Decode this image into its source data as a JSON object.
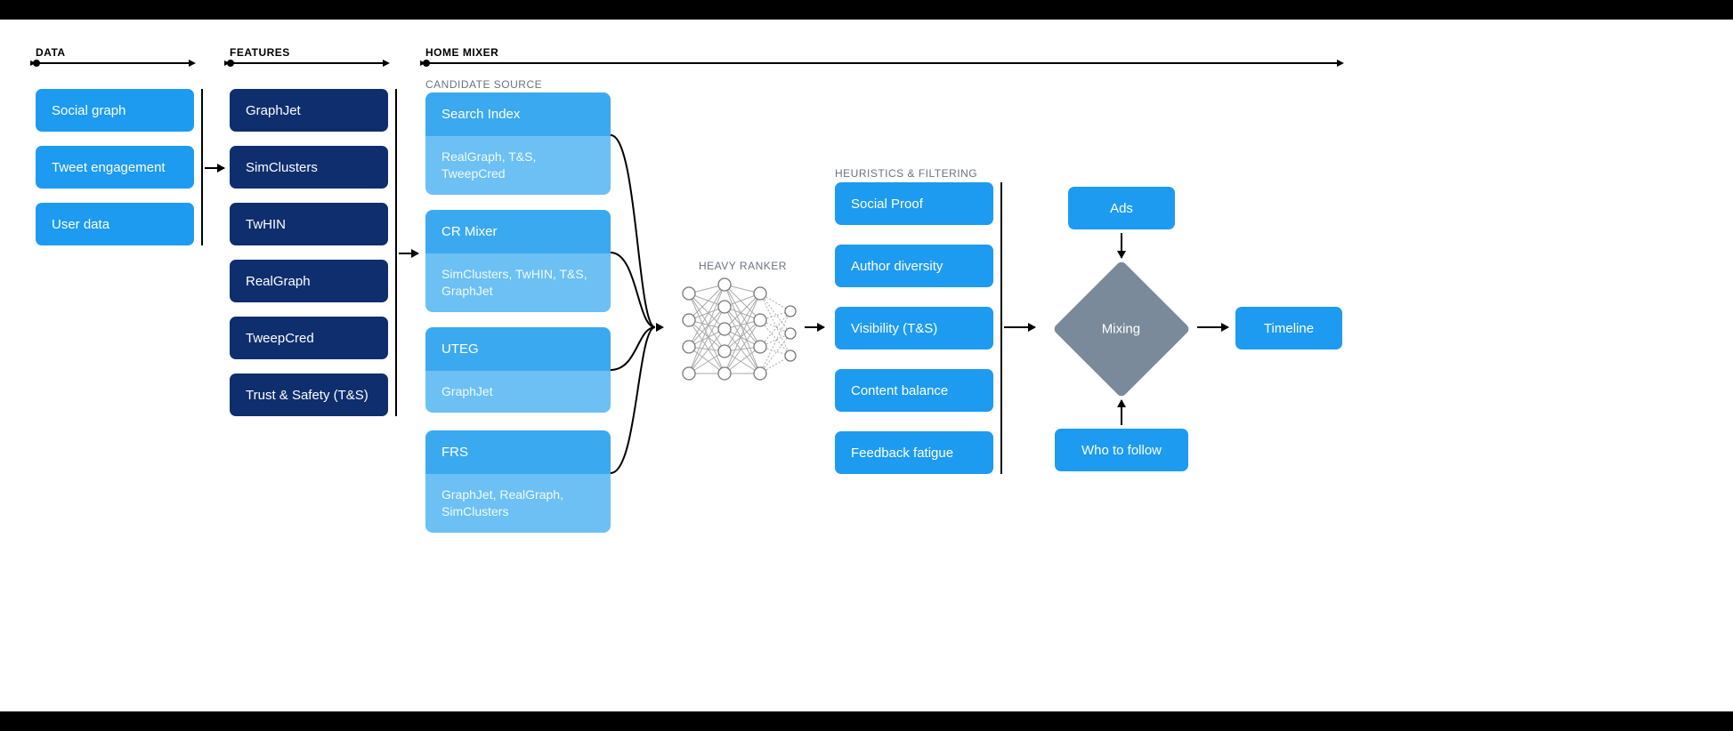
{
  "sections": {
    "data": "DATA",
    "features": "FEATURES",
    "home_mixer": "HOME MIXER"
  },
  "subsections": {
    "candidate_source": "CANDIDATE SOURCE",
    "heavy_ranker": "HEAVY RANKER",
    "heuristics": "HEURISTICS & FILTERING"
  },
  "data_col": [
    "Social graph",
    "Tweet engagement",
    "User data"
  ],
  "features_col": [
    "GraphJet",
    "SimClusters",
    "TwHIN",
    "RealGraph",
    "TweepCred",
    "Trust & Safety (T&S)"
  ],
  "candidates": [
    {
      "name": "Search Index",
      "uses": "RealGraph, T&S, TweepCred"
    },
    {
      "name": "CR Mixer",
      "uses": "SimClusters, TwHIN, T&S, GraphJet"
    },
    {
      "name": "UTEG",
      "uses": "GraphJet"
    },
    {
      "name": "FRS",
      "uses": "GraphJet, RealGraph, SimClusters"
    }
  ],
  "heuristics": [
    "Social Proof",
    "Author diversity",
    "Visibility (T&S)",
    "Content balance",
    "Feedback fatigue"
  ],
  "mixing": {
    "label": "Mixing",
    "ads": "Ads",
    "wtf": "Who to follow"
  },
  "output": "Timeline"
}
